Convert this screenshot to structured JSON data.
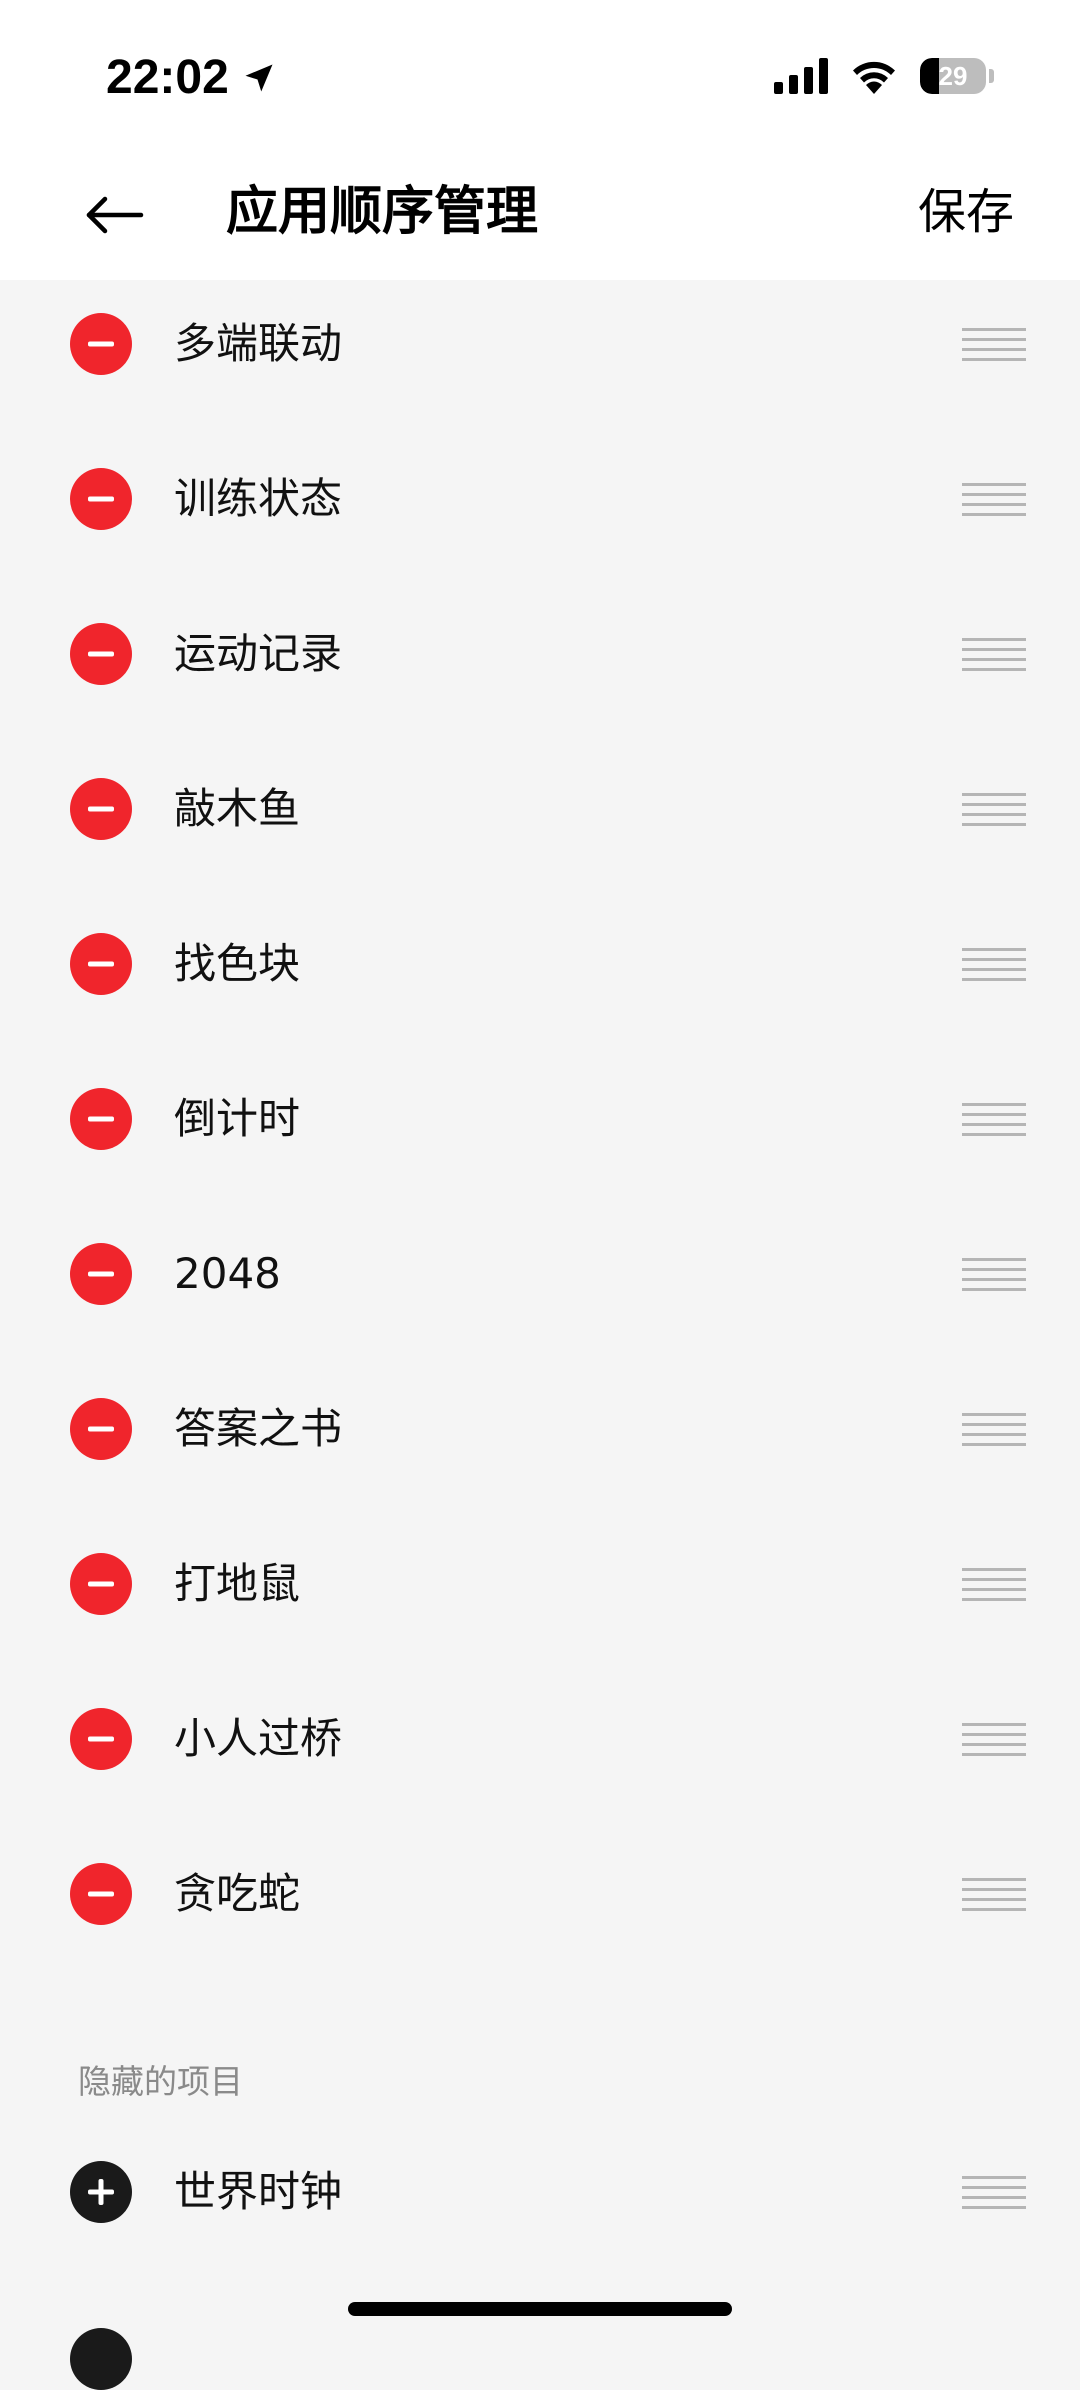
{
  "status_bar": {
    "time": "22:02",
    "battery_level": "29",
    "battery_percent": 29
  },
  "header": {
    "title": "应用顺序管理",
    "save_label": "保存"
  },
  "visible_items": [
    "多端联动",
    "训练状态",
    "运动记录",
    "敲木鱼",
    "找色块",
    "倒计时",
    "2048",
    "答案之书",
    "打地鼠",
    "小人过桥",
    "贪吃蛇"
  ],
  "hidden_section": {
    "title": "隐藏的项目",
    "items": [
      "世界时钟"
    ]
  },
  "icons": {
    "remove": "minus-circle-icon",
    "add": "plus-circle-icon",
    "drag": "drag-handle-icon",
    "back": "arrow-left-icon"
  },
  "colors": {
    "remove": "#f0252c",
    "add": "#1a1a1a",
    "background": "#f5f5f5"
  }
}
